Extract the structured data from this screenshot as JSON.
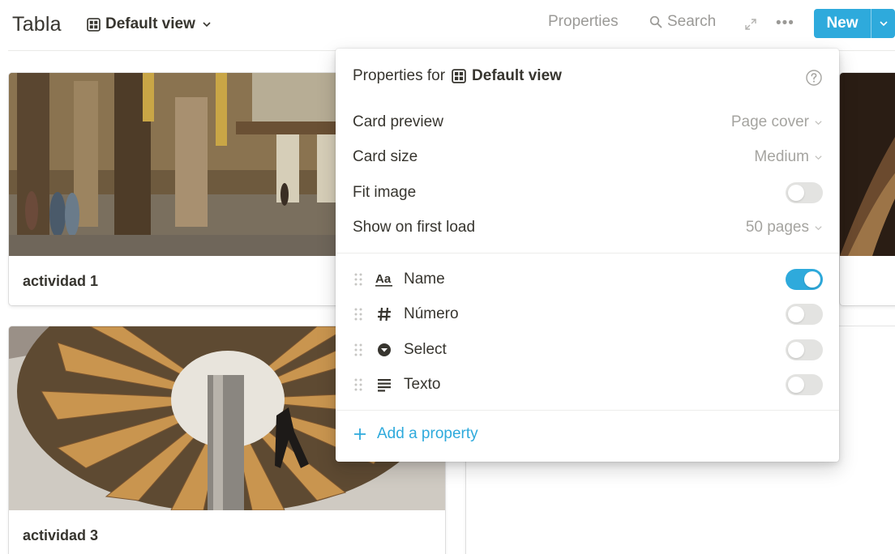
{
  "header": {
    "title": "Tabla",
    "view_name": "Default view",
    "properties_label": "Properties",
    "search_label": "Search",
    "more_label": "•••",
    "new_label": "New"
  },
  "cards": [
    {
      "title": "actividad 1",
      "cover": "church-interior-painting"
    },
    {
      "title": "",
      "cover": "dark-wood-image"
    },
    {
      "title": "actividad 3",
      "cover": "wind-tunnel-fan-photo"
    },
    {
      "title": ""
    }
  ],
  "popup": {
    "heading_prefix": "Properties for",
    "view_name": "Default view",
    "options": [
      {
        "label": "Card preview",
        "value": "Page cover"
      },
      {
        "label": "Card size",
        "value": "Medium"
      },
      {
        "label": "Fit image",
        "toggle": false
      },
      {
        "label": "Show on first load",
        "value": "50 pages"
      }
    ],
    "properties": [
      {
        "label": "Name",
        "icon": "title-aa-icon",
        "visible": true
      },
      {
        "label": "Número",
        "icon": "number-hash-icon",
        "visible": false
      },
      {
        "label": "Select",
        "icon": "select-chevron-icon",
        "visible": false
      },
      {
        "label": "Texto",
        "icon": "text-lines-icon",
        "visible": false
      }
    ],
    "add_property_label": "Add a property"
  },
  "colors": {
    "accent": "#2eaadc",
    "text": "#37352f",
    "muted": "#9b9a97",
    "toggle_off": "#e3e3e1"
  }
}
